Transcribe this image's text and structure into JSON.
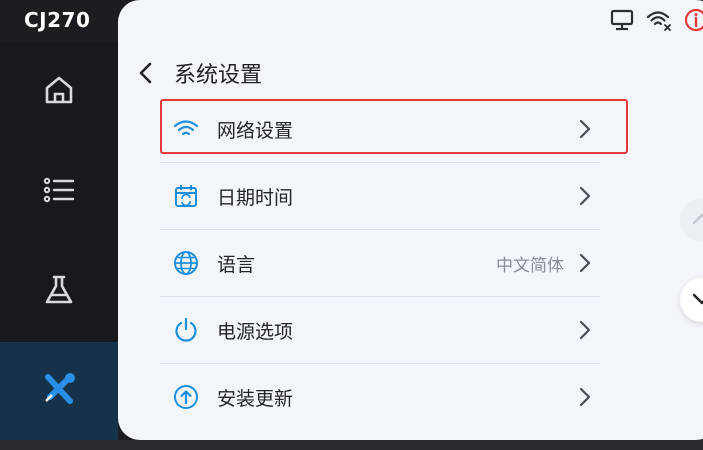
{
  "device": {
    "title": "CJ270"
  },
  "sidebar": {
    "items": [
      {
        "icon": "home-icon",
        "active": false
      },
      {
        "icon": "list-icon",
        "active": false
      },
      {
        "icon": "flask-icon",
        "active": false
      },
      {
        "icon": "tools-icon",
        "active": true
      }
    ]
  },
  "status_bar": {
    "icons": [
      "monitor-icon",
      "wifi-disconnected-icon",
      "alert-info-icon"
    ],
    "alert_color": "#e53a3a"
  },
  "header": {
    "title": "系统设置"
  },
  "menu": {
    "items": [
      {
        "label": "网络设置",
        "icon": "wifi-icon",
        "value": "",
        "highlighted": true
      },
      {
        "label": "日期时间",
        "icon": "calendar-sync-icon",
        "value": ""
      },
      {
        "label": "语言",
        "icon": "globe-icon",
        "value": "中文简体"
      },
      {
        "label": "电源选项",
        "icon": "power-icon",
        "value": ""
      },
      {
        "label": "安装更新",
        "icon": "upload-icon",
        "value": ""
      }
    ]
  },
  "colors": {
    "accent": "#1e8fe0",
    "panel_bg": "#f2f5fa",
    "sidebar_bg": "#17191c",
    "active_bg": "#16324a"
  }
}
